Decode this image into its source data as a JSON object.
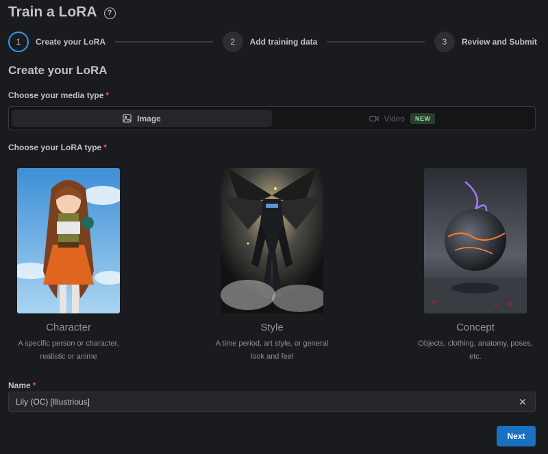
{
  "header": {
    "title": "Train a LoRA",
    "help_icon": "?"
  },
  "stepper": {
    "steps": [
      {
        "number": "1",
        "label": "Create your LoRA"
      },
      {
        "number": "2",
        "label": "Add training data"
      },
      {
        "number": "3",
        "label": "Review and Submit"
      }
    ]
  },
  "main": {
    "section_title": "Create your LoRA",
    "media_type_label": "Choose your media type",
    "media_options": [
      {
        "label": "Image",
        "icon": "image-icon"
      },
      {
        "label": "Video",
        "icon": "video-icon",
        "badge": "NEW"
      }
    ],
    "lora_type_label": "Choose your LoRA type",
    "lora_types": [
      {
        "title": "Character",
        "description": "A specific person or character, realistic or anime"
      },
      {
        "title": "Style",
        "description": "A time period, art style, or general look and feel"
      },
      {
        "title": "Concept",
        "description": "Objects, clothing, anatomy, poses, etc."
      }
    ],
    "name_label": "Name",
    "name_value": "Lily (OC) [Illustrious]",
    "required_mark": "*",
    "next_label": "Next"
  },
  "colors": {
    "accent": "#339af0",
    "primary_button": "#1971c2",
    "required": "#fa5252",
    "new_badge": "#8ce99a"
  }
}
